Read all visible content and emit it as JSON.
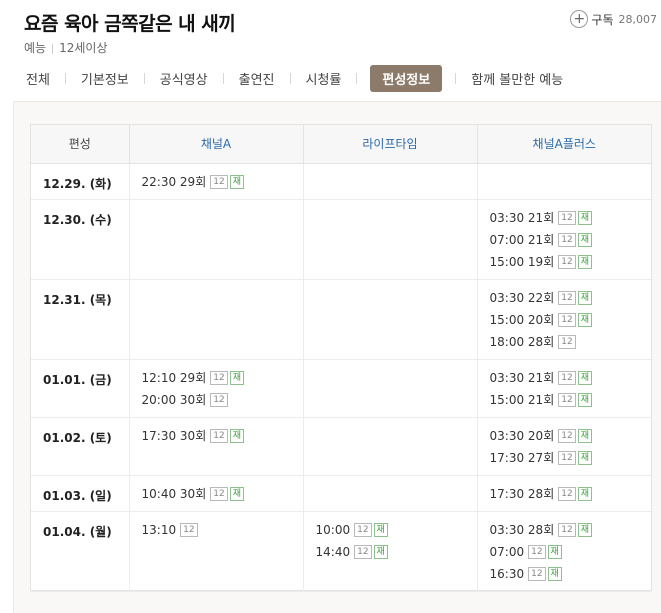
{
  "program": {
    "title": "요즘 육아 금쪽같은 내 새끼",
    "genre": "예능",
    "rating": "12세이상",
    "subscribe_label": "구독",
    "subscribe_count": "28,007"
  },
  "tabs": [
    "전체",
    "기본정보",
    "공식영상",
    "출연진",
    "시청률",
    "편성정보",
    "함께 볼만한 예능"
  ],
  "active_tab": "편성정보",
  "schedule": {
    "header": [
      "편성",
      "채널A",
      "라이프타임",
      "채널A플러스"
    ],
    "rows": [
      {
        "date": "12.29. (화)",
        "ch1": [
          {
            "time": "22:30",
            "ep": "29회",
            "age": "12",
            "rerun": "재"
          }
        ],
        "ch2": [],
        "ch3": []
      },
      {
        "date": "12.30. (수)",
        "ch1": [],
        "ch2": [],
        "ch3": [
          {
            "time": "03:30",
            "ep": "21회",
            "age": "12",
            "rerun": "재"
          },
          {
            "time": "07:00",
            "ep": "21회",
            "age": "12",
            "rerun": "재"
          },
          {
            "time": "15:00",
            "ep": "19회",
            "age": "12",
            "rerun": "재"
          }
        ]
      },
      {
        "date": "12.31. (목)",
        "ch1": [],
        "ch2": [],
        "ch3": [
          {
            "time": "03:30",
            "ep": "22회",
            "age": "12",
            "rerun": "재"
          },
          {
            "time": "15:00",
            "ep": "20회",
            "age": "12",
            "rerun": "재"
          },
          {
            "time": "18:00",
            "ep": "28회",
            "age": "12",
            "rerun": ""
          }
        ]
      },
      {
        "date": "01.01. (금)",
        "ch1": [
          {
            "time": "12:10",
            "ep": "29회",
            "age": "12",
            "rerun": "재"
          },
          {
            "time": "20:00",
            "ep": "30회",
            "age": "12",
            "rerun": ""
          }
        ],
        "ch2": [],
        "ch3": [
          {
            "time": "03:30",
            "ep": "21회",
            "age": "12",
            "rerun": "재"
          },
          {
            "time": "15:00",
            "ep": "21회",
            "age": "12",
            "rerun": "재"
          }
        ]
      },
      {
        "date": "01.02. (토)",
        "ch1": [
          {
            "time": "17:30",
            "ep": "30회",
            "age": "12",
            "rerun": "재"
          }
        ],
        "ch2": [],
        "ch3": [
          {
            "time": "03:30",
            "ep": "20회",
            "age": "12",
            "rerun": "재"
          },
          {
            "time": "17:30",
            "ep": "27회",
            "age": "12",
            "rerun": "재"
          }
        ]
      },
      {
        "date": "01.03. (일)",
        "ch1": [
          {
            "time": "10:40",
            "ep": "30회",
            "age": "12",
            "rerun": "재"
          }
        ],
        "ch2": [],
        "ch3": [
          {
            "time": "17:30",
            "ep": "28회",
            "age": "12",
            "rerun": "재"
          }
        ]
      },
      {
        "date": "01.04. (월)",
        "ch1": [
          {
            "time": "13:10",
            "ep": "",
            "age": "12",
            "rerun": ""
          }
        ],
        "ch2": [
          {
            "time": "10:00",
            "ep": "",
            "age": "12",
            "rerun": "재"
          },
          {
            "time": "14:40",
            "ep": "",
            "age": "12",
            "rerun": "재"
          }
        ],
        "ch3": [
          {
            "time": "03:30",
            "ep": "28회",
            "age": "12",
            "rerun": "재"
          },
          {
            "time": "07:00",
            "ep": "",
            "age": "12",
            "rerun": "재"
          },
          {
            "time": "16:30",
            "ep": "",
            "age": "12",
            "rerun": "재"
          }
        ]
      }
    ]
  }
}
